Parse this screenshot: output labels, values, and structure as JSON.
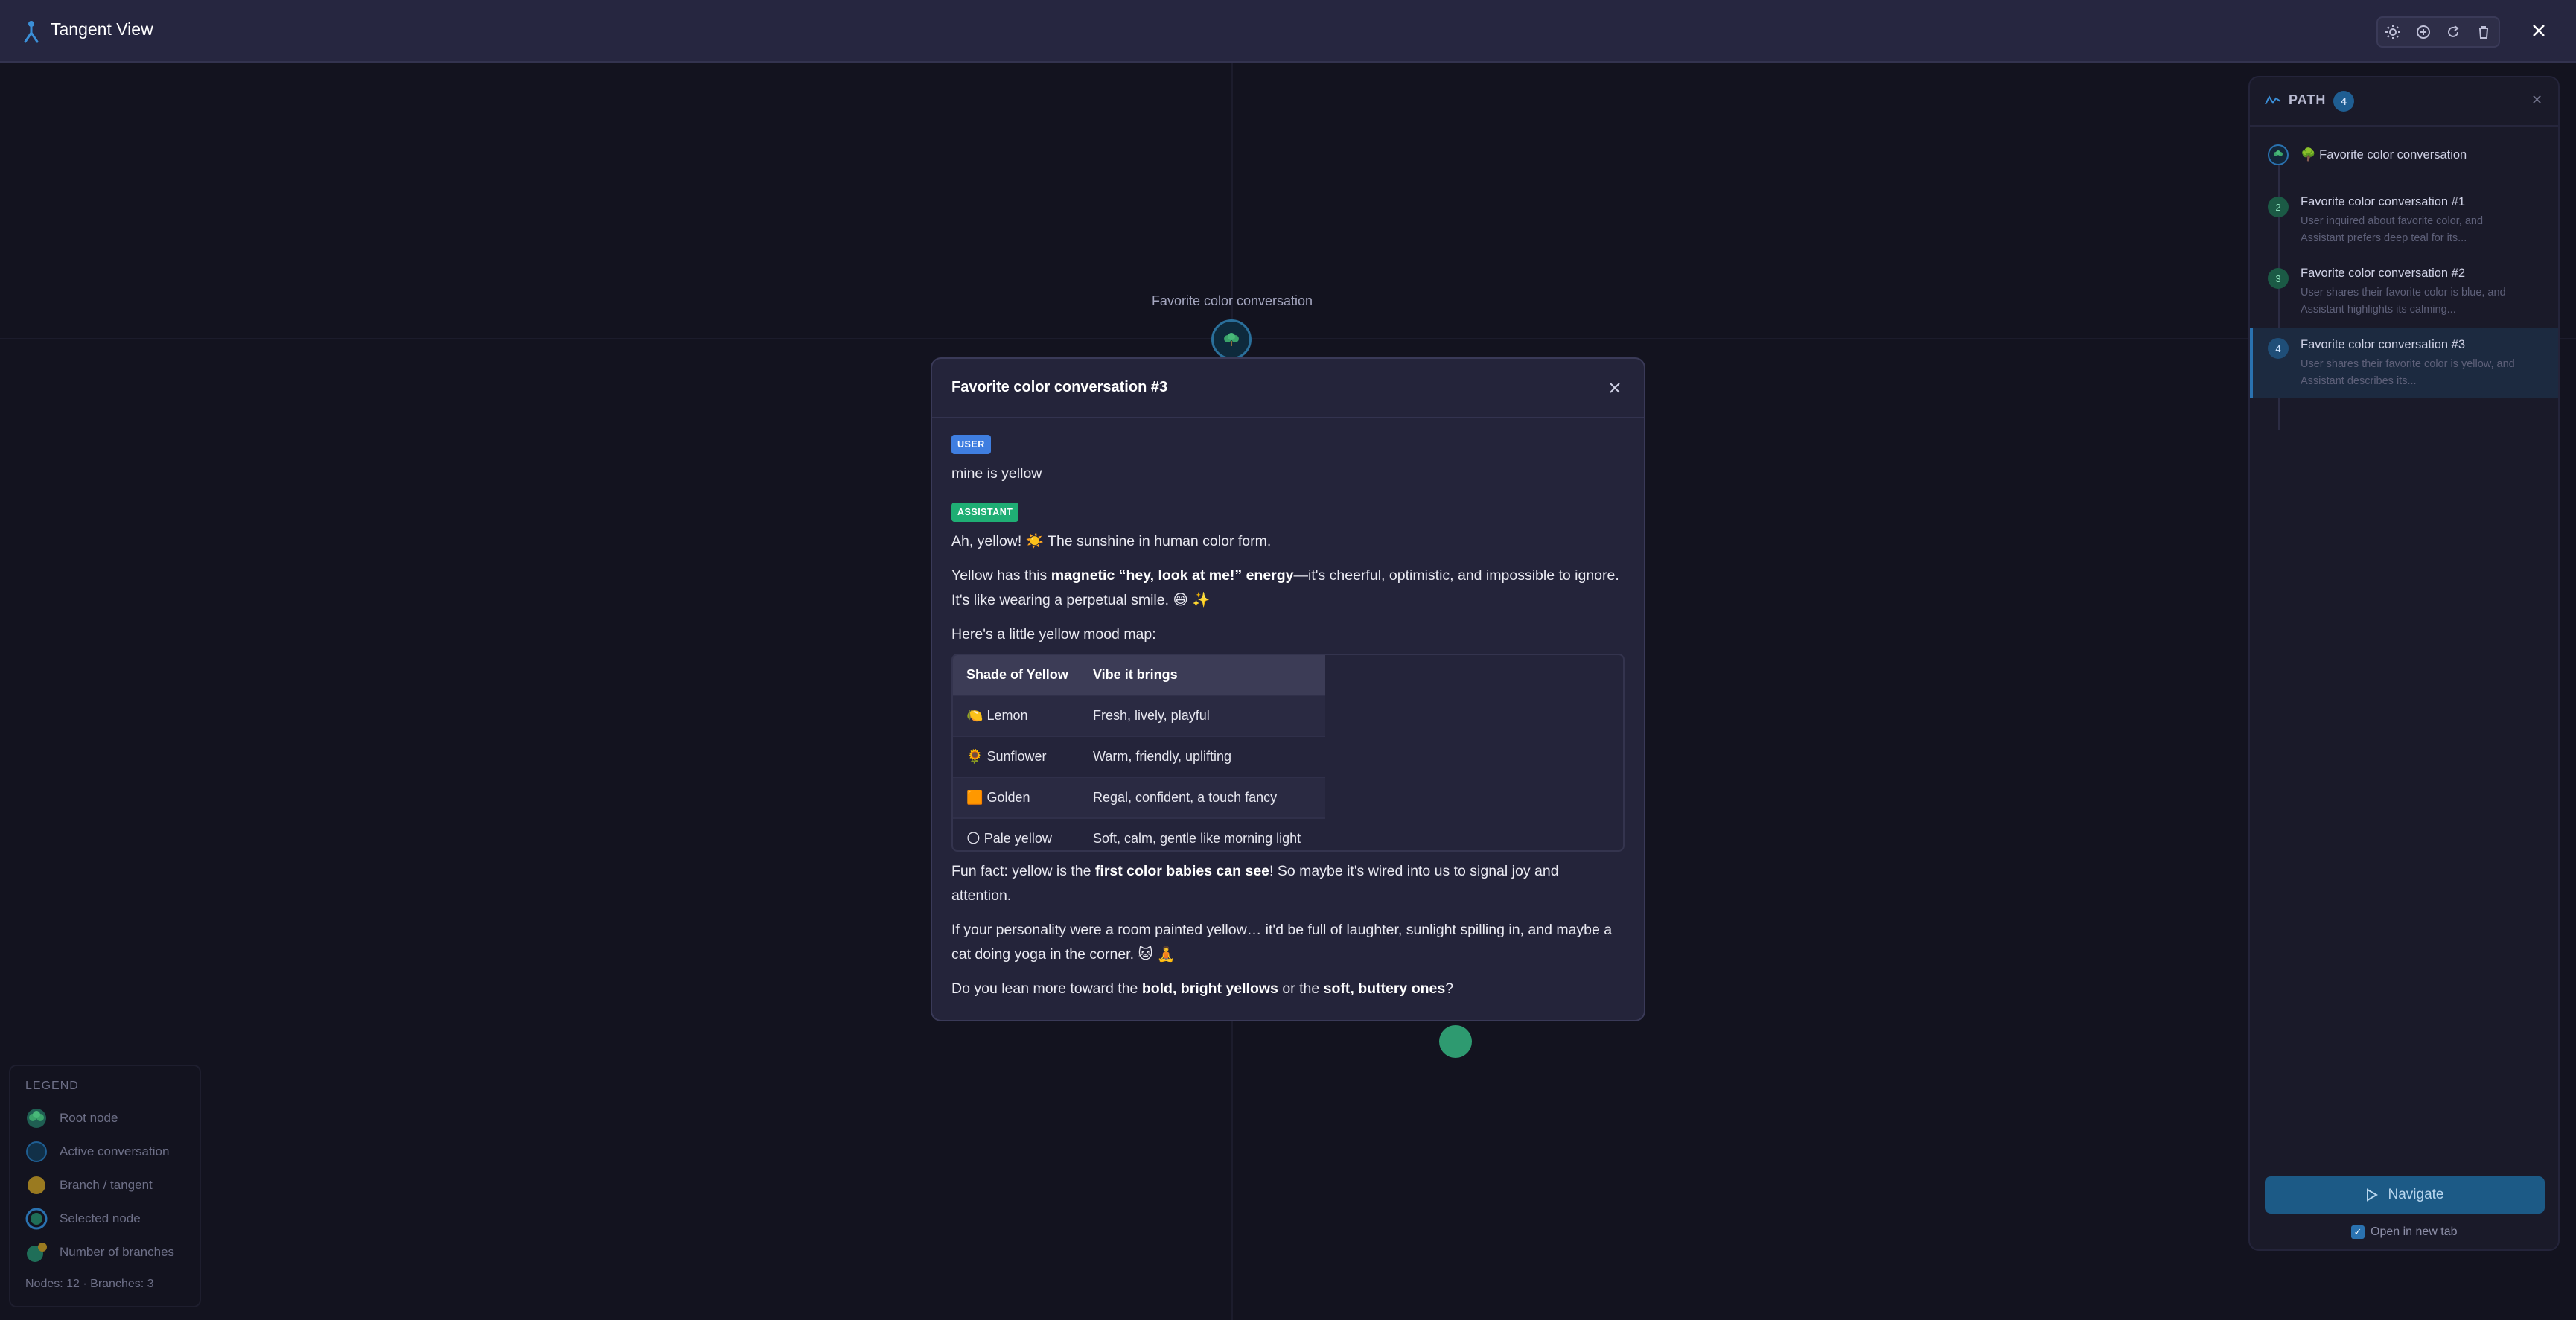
{
  "app": {
    "title": "Tangent View",
    "accent": "#2a72b0"
  },
  "toolbar": {
    "buttons": [
      {
        "name": "sun-icon"
      },
      {
        "name": "add-circle-icon"
      },
      {
        "name": "refresh-icon"
      },
      {
        "name": "trash-icon"
      }
    ],
    "close_icon": "close-icon"
  },
  "canvas": {
    "root_label": "Favorite color conversation"
  },
  "legend": {
    "title": "LEGEND",
    "items": [
      {
        "label": "Root node",
        "icon": "root-node-icon"
      },
      {
        "label": "Active conversation",
        "icon": "active-conversation-icon"
      },
      {
        "label": "Branch / tangent",
        "icon": "branch-icon"
      },
      {
        "label": "Selected node",
        "icon": "selected-node-icon"
      },
      {
        "label": "Number of branches",
        "icon": "branch-count-icon"
      }
    ],
    "stats": "Nodes: 12 · Branches: 3"
  },
  "path_panel": {
    "title": "PATH",
    "count": "4",
    "items": [
      {
        "step": "",
        "title": "🌳 Favorite color conversation",
        "summary": ""
      },
      {
        "step": "2",
        "title": "Favorite color conversation #1",
        "summary": "User inquired about favorite color, and Assistant prefers deep teal for its..."
      },
      {
        "step": "3",
        "title": "Favorite color conversation #2",
        "summary": "User shares their favorite color is blue, and Assistant highlights its calming..."
      },
      {
        "step": "4",
        "title": "Favorite color conversation #3",
        "summary": "User shares their favorite color is yellow, and Assistant describes its..."
      }
    ],
    "navigate_label": "Navigate",
    "open_new_tab_label": "Open in new tab",
    "open_new_tab_checked": true
  },
  "modal": {
    "title": "Favorite color conversation #3",
    "user_role": "USER",
    "user_message": "mine is yellow",
    "assistant_role": "ASSISTANT",
    "p1": "Ah, yellow! ☀️ The sunshine in human color form.",
    "p2_a": "Yellow has this ",
    "p2_b": "magnetic “hey, look at me!” energy",
    "p2_c": "—it's cheerful, optimistic, and impossible to ignore. It's like wearing a perpetual smile. 😄 ✨",
    "p3": "Here's a little yellow mood map:",
    "table": {
      "headers": [
        "Shade of Yellow",
        "Vibe it brings"
      ],
      "rows": [
        {
          "emoji": "🍋",
          "shade": "Lemon",
          "vibe": "Fresh, lively, playful"
        },
        {
          "emoji": "🌻",
          "shade": "Sunflower",
          "vibe": "Warm, friendly, uplifting"
        },
        {
          "emoji": "🟧",
          "shade": "Golden",
          "vibe": "Regal, confident, a touch fancy"
        },
        {
          "emoji": "🌕",
          "shade": "Pale yellow",
          "vibe": "Soft, calm, gentle like morning light"
        }
      ]
    },
    "p4_a": "Fun fact: yellow is the ",
    "p4_b": "first color babies can see",
    "p4_c": "! So maybe it's wired into us to signal joy and attention.",
    "p5": "If your personality were a room painted yellow… it'd be full of laughter, sunlight spilling in, and maybe a cat doing yoga in the corner. 🐱 🧘",
    "p6_a": "Do you lean more toward the ",
    "p6_b": "bold, bright yellows",
    "p6_c": " or the ",
    "p6_d": "soft, buttery ones",
    "p6_e": "?"
  }
}
